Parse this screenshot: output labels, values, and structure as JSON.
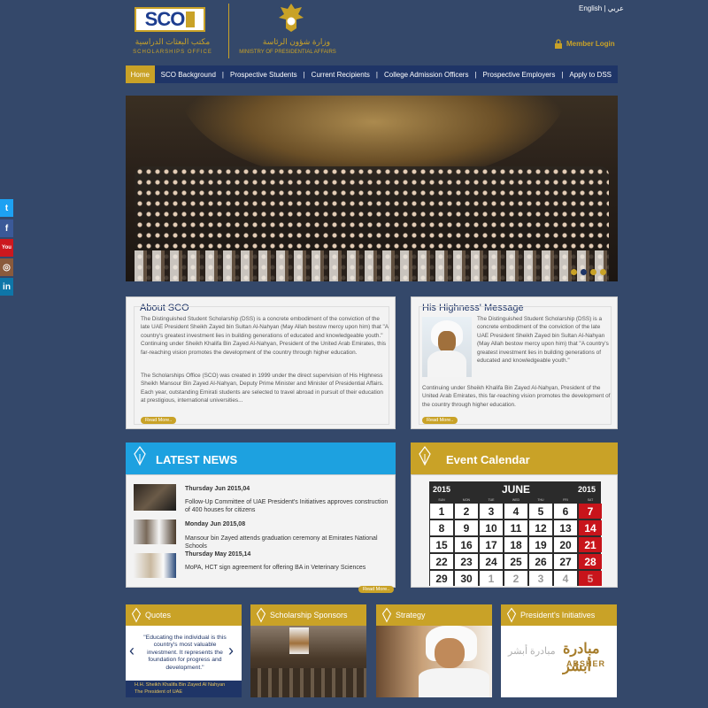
{
  "header": {
    "logo_text": "SCO",
    "logo_arabic": "مكتب البعثات الدراسية",
    "logo_subtitle": "SCHOLARSHIPS OFFICE",
    "ministry_arabic": "وزارة شؤون الرئاسة",
    "ministry_english": "MINISTRY OF PRESIDENTIAL AFFAIRS",
    "lang_en": "English",
    "lang_ar": "عربي",
    "member_login": "Member Login"
  },
  "nav": {
    "items": [
      "Home",
      "SCO Background",
      "Prospective Students",
      "Current Recipients",
      "College Admission Officers",
      "Prospective Employers",
      "Apply to DSS"
    ]
  },
  "social": [
    "twitter",
    "facebook",
    "youtube",
    "instagram",
    "linkedin"
  ],
  "about": {
    "title": "About SCO",
    "p1": "The Distinguished Student Scholarship (DSS) is a concrete embodiment of the conviction of the late UAE President Sheikh Zayed bin Sultan Al-Nahyan (May Allah bestow mercy upon him) that \"A country's greatest investment lies in building generations of educated and knowledgeable youth.\" Continuing under Sheikh Khalifa Bin Zayed Al-Nahyan, President of the United Arab Emirates, this far-reaching vision promotes the development of the country through higher education.",
    "p2": "The Scholarships Office (SCO) was created in 1999 under the direct supervision of His Highness Sheikh Mansour Bin Zayed Al-Nahyan, Deputy Prime Minister and Minister of Presidential Affairs. Each year, outstanding Emirati students are selected to travel abroad in pursuit of their education at prestigious, international universities...",
    "read_more": "Read More.."
  },
  "message": {
    "title": "His Highness' Message",
    "p1": "The Distinguished Student Scholarship (DSS) is a concrete embodiment of the conviction of the late UAE President Sheikh Zayed bin Sultan Al-Nahyan (May Allah bestow mercy upon him) that \"A country's greatest investment lies in building generations of educated and knowledgeable youth.\"",
    "p2": "Continuing under Sheikh Khalifa Bin Zayed Al-Nahyan, President of the United Arab Emirates, this far-reaching vision promotes the development of the country through higher education.",
    "read_more": "Read More.."
  },
  "news": {
    "title": "LATEST NEWS",
    "items": [
      {
        "date": "Thursday Jun 2015,04",
        "text": "Follow-Up Committee of UAE President's Initiatives approves construction of 400 houses for citizens"
      },
      {
        "date": "Monday Jun 2015,08",
        "text": "Mansour bin Zayed attends graduation ceremony at Emirates National Schools"
      },
      {
        "date": "Thursday May 2015,14",
        "text": "MoPA, HCT sign agreement for offering BA in Veterinary Sciences"
      }
    ],
    "read_more": "Read More.."
  },
  "calendar": {
    "title": "Event Calendar",
    "year": "2015",
    "month": "JUNE",
    "days_of_week": [
      "SUN",
      "MON",
      "TUE",
      "WED",
      "THU",
      "FRI",
      "SAT"
    ],
    "rows": [
      [
        "1",
        "2",
        "3",
        "4",
        "5",
        "6",
        "7"
      ],
      [
        "8",
        "9",
        "10",
        "11",
        "12",
        "13",
        "14"
      ],
      [
        "15",
        "16",
        "17",
        "18",
        "19",
        "20",
        "21"
      ],
      [
        "22",
        "23",
        "24",
        "25",
        "26",
        "27",
        "28"
      ],
      [
        "29",
        "30",
        "1",
        "2",
        "3",
        "4",
        "5"
      ]
    ]
  },
  "tiles": {
    "quotes": {
      "title": "Quotes",
      "quote": "\"Educating the individual is this country's most valuable investment. It represents the foundation for progress and development.\"",
      "author": "H.H. Sheikh Khalifa Bin Zayed Al Nahyan",
      "author_title": "The President of UAE"
    },
    "sponsors": {
      "title": "Scholarship Sponsors"
    },
    "strategy": {
      "title": "Strategy"
    },
    "initiatives": {
      "title": "President's Initiatives",
      "brand_en": "ABSHER",
      "brand_ar": "مبادرة أبشر"
    }
  },
  "colors": {
    "background": "#34486a",
    "gold": "#c9a227",
    "navy": "#1f3567",
    "blue": "#1da1e0",
    "red": "#c8141b"
  }
}
